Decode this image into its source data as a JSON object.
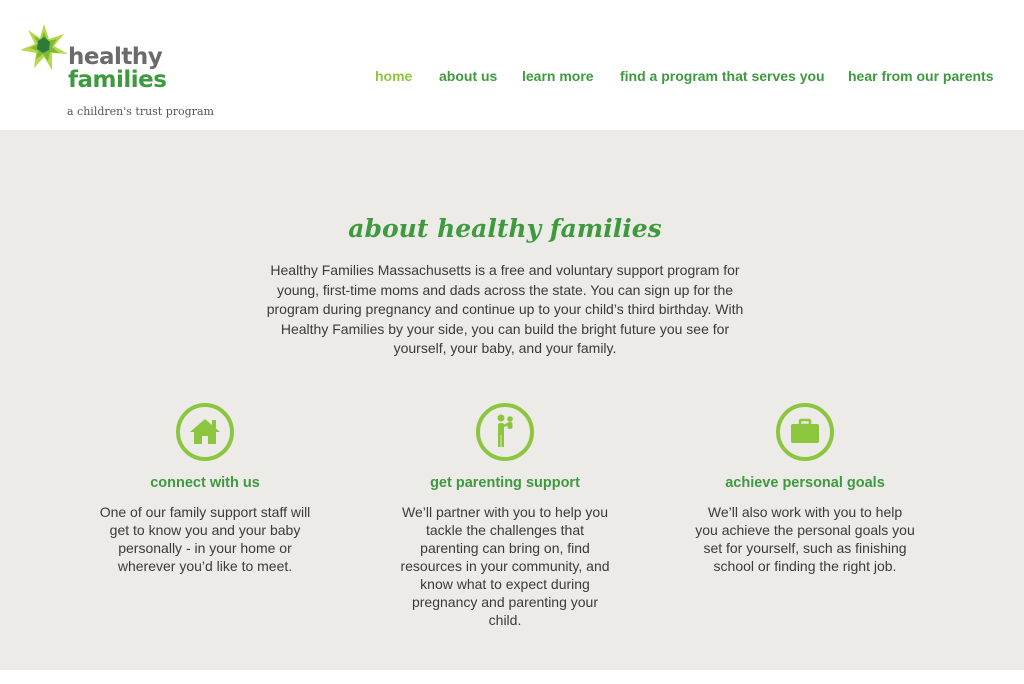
{
  "logo": {
    "line1": "healthy",
    "line2": "families",
    "tagline": "a children's trust program"
  },
  "nav": {
    "items": [
      {
        "label": "home"
      },
      {
        "label": "about us"
      },
      {
        "label": "learn more"
      },
      {
        "label": "find a program that serves you"
      },
      {
        "label": "hear from our parents"
      }
    ]
  },
  "about": {
    "title": "about healthy families",
    "text": "Healthy Families Massachusetts is a free and voluntary support program for young, first-time moms and dads across the state. You can sign up for the program during pregnancy and continue up to your child’s third birthday. With Healthy Families by your side, you can build the bright future you see for yourself, your baby, and your family."
  },
  "features": [
    {
      "icon": "house-icon",
      "title": "connect with us",
      "text": "One of our family support staff will get to know you and your baby personally - in your home or wherever you’d like to meet."
    },
    {
      "icon": "parent-child-icon",
      "title": "get parenting support",
      "text": "We’ll partner with you to help you tackle the challenges that parenting can bring on, find resources in your community, and know what to expect during pregnancy and parenting your child."
    },
    {
      "icon": "briefcase-icon",
      "title": "achieve personal goals",
      "text": "We’ll also work with you to help you achieve the personal goals you set for yourself, such as finishing school or finding the right job."
    }
  ],
  "colors": {
    "brand_green": "#3e9a3e",
    "light_green": "#8cc63f",
    "background": "#ecebe8"
  }
}
